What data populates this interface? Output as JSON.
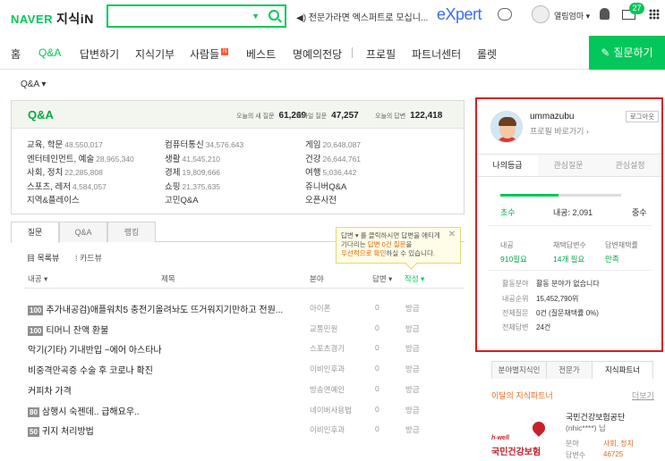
{
  "header": {
    "brand": "NAVER",
    "service": "지식iN",
    "search_placeholder": "",
    "notice": "◀) 전문가라면 엑스퍼트로 모십니...",
    "expert": "eXpert",
    "user": "열림엄마 ▾",
    "mail_count": "27"
  },
  "nav": {
    "items": [
      "홈",
      "Q&A",
      "답변하기",
      "지식기부",
      "사람들",
      "베스트",
      "명예의전당",
      "프로필",
      "파트너센터",
      "롤렛"
    ],
    "active": "Q&A",
    "new_badge": "N",
    "ask_label": "질문하기"
  },
  "breadcrumb": "Q&A ▾",
  "qa": {
    "title": "Q&A",
    "stats": [
      {
        "label": "오늘의 새 질문",
        "value": "61,269"
      },
      {
        "label": "모바일 질문",
        "value": "47,257"
      },
      {
        "label": "오늘의 답변",
        "value": "122,418"
      }
    ],
    "categories": [
      {
        "name": "교육, 학문",
        "count": "48,550,017"
      },
      {
        "name": "컴퓨터통신",
        "count": "34,576,643"
      },
      {
        "name": "게임",
        "count": "20,648,087"
      },
      {
        "name": "엔터테인먼트, 예술",
        "count": "28,965,340"
      },
      {
        "name": "생활",
        "count": "41,545,210"
      },
      {
        "name": "건강",
        "count": "26,644,761"
      },
      {
        "name": "사회, 정치",
        "count": "22,285,808"
      },
      {
        "name": "경제",
        "count": "19,809,666"
      },
      {
        "name": "여행",
        "count": "5,036,442"
      },
      {
        "name": "스포츠, 레저",
        "count": "4,584,057"
      },
      {
        "name": "쇼핑",
        "count": "21,375,635"
      },
      {
        "name": "쥬니버Q&A",
        "count": ""
      },
      {
        "name": "지역&플레이스",
        "count": ""
      },
      {
        "name": "고민Q&A",
        "count": ""
      },
      {
        "name": "오픈사전",
        "count": ""
      }
    ]
  },
  "list": {
    "tabs": [
      "질문",
      "Q&A",
      "랭킹"
    ],
    "view_options": [
      "目 목록뷰",
      "카드뷰"
    ],
    "tooltip": {
      "line1": "답변 ▾ 를 클릭하시면 답변을 애티게",
      "line2a": "기다리는 ",
      "line2b": "답변 0건 질문",
      "line2c": "을",
      "line3a": "우선적으로 확인",
      "line3b": "하실 수 있습니다."
    },
    "columns": {
      "points": "내공 ▾",
      "title": "제목",
      "field": "분야",
      "answers": "답변 ▾",
      "date": "작성 ▾"
    },
    "rows": [
      {
        "badge": "100",
        "title": "추가내공검)애플워치5 충전기올려놔도 뜨거워지기만하고 전원...",
        "field": "아이폰",
        "answers": "0",
        "date": "방금"
      },
      {
        "badge": "100",
        "title": "티머니 잔액 환불",
        "field": "교통민원",
        "answers": "0",
        "date": "방금"
      },
      {
        "badge": "",
        "title": "악기(기타) 기내반입 ~에어 아스타나",
        "field": "스포츠경기",
        "answers": "0",
        "date": "방금"
      },
      {
        "badge": "",
        "title": "비중격만곡증 수술 후 코로나 확진",
        "field": "이비인후과",
        "answers": "0",
        "date": "방금"
      },
      {
        "badge": "",
        "title": "커피차 가격",
        "field": "방송연예인",
        "answers": "0",
        "date": "방금"
      },
      {
        "badge": "80",
        "title": "삼행시 숙젠데.. 급해요우..",
        "field": "네이버사용법",
        "answers": "0",
        "date": "방금"
      },
      {
        "badge": "50",
        "title": "귀지 처리방법",
        "field": "이비인후과",
        "answers": "0",
        "date": "방금"
      }
    ]
  },
  "profile": {
    "name": "ummazubu",
    "link": "프로필 바로가기 ›",
    "logout": "로그아웃",
    "tabs": [
      "나의등급",
      "관심질문",
      "관심설정"
    ],
    "grade_current": "초수",
    "grade_points": "내공: 2,091",
    "grade_next": "중수",
    "grade_progress": 0.48,
    "kv": [
      {
        "label": "내공",
        "value": "910필요"
      },
      {
        "label": "채택답변수",
        "value": "14개 필요"
      },
      {
        "label": "답변채택률",
        "value": "만족"
      }
    ],
    "activity": [
      {
        "label": "활동분야",
        "value": "활동 분야가 없습니다"
      },
      {
        "label": "내공순위",
        "value": "15,452,790위"
      },
      {
        "label": "전체질문",
        "value": "0건 (질문채택률 0%)"
      },
      {
        "label": "전체답변",
        "value": "24건"
      }
    ]
  },
  "partner": {
    "tabs": [
      "분야별지식인",
      "전문가",
      "지식파트너"
    ],
    "heading": "이달의 지식파트너",
    "more": "더보기",
    "logo_small": "h-well",
    "logo_name": "국민건강보험",
    "name": "국민건강보험공단",
    "id": "(nhic****) 님",
    "field_label": "분야",
    "field_value": "사회, 정치",
    "answers_label": "답변수",
    "answers_value": "46725"
  },
  "colors": {
    "brand": "#03c75a",
    "highlight": "#e0191f",
    "accent_orange": "#e96a1e"
  }
}
